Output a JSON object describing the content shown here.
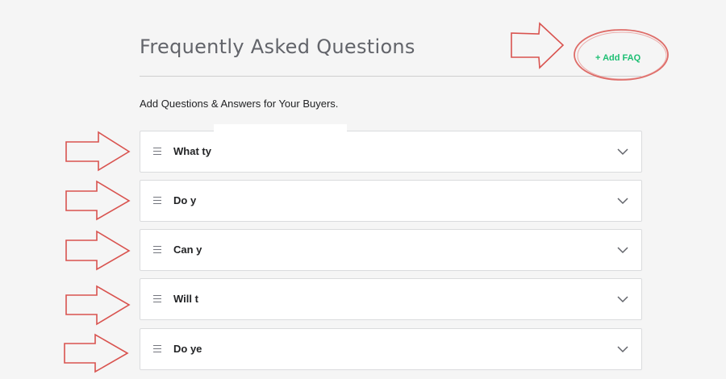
{
  "header": {
    "title": "Frequently Asked Questions",
    "add_label": "+ Add FAQ"
  },
  "subtitle": "Add Questions & Answers for Your Buyers.",
  "faqs": [
    {
      "question": "What ty"
    },
    {
      "question": "Do y"
    },
    {
      "question": "Can y"
    },
    {
      "question": "Will t"
    },
    {
      "question": "Do ye"
    }
  ],
  "colors": {
    "accent": "#1dbf73",
    "annotation": "#d9534f"
  },
  "icons": {
    "drag": "drag-handle-icon",
    "expand": "chevron-down-icon",
    "pointer": "arrow-annotation"
  }
}
